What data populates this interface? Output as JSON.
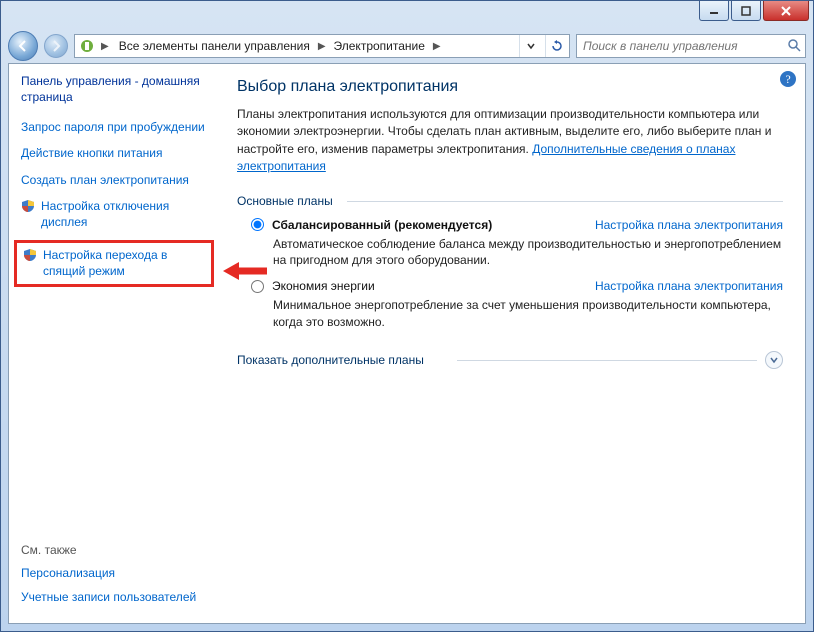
{
  "breadcrumb": {
    "item1": "Все элементы панели управления",
    "item2": "Электропитание"
  },
  "search": {
    "placeholder": "Поиск в панели управления"
  },
  "sidebar": {
    "title": "Панель управления - домашняя страница",
    "links": {
      "l0": "Запрос пароля при пробуждении",
      "l1": "Действие кнопки питания",
      "l2": "Создать план электропитания",
      "l3": "Настройка отключения дисплея",
      "l4": "Настройка перехода в спящий режим"
    },
    "seealso_head": "См. также",
    "seealso": {
      "s0": "Персонализация",
      "s1": "Учетные записи пользователей"
    }
  },
  "main": {
    "title": "Выбор плана электропитания",
    "desc_part1": "Планы электропитания используются для оптимизации производительности компьютера или экономии электроэнергии. Чтобы сделать план активным, выделите его, либо выберите план и настройте его, изменив параметры электропитания. ",
    "desc_link": "Дополнительные сведения о планах электропитания",
    "section_main": "Основные планы",
    "plans": {
      "balanced": {
        "name": "Сбалансированный (рекомендуется)",
        "settings": "Настройка плана электропитания",
        "desc": "Автоматическое соблюдение баланса между производительностью и энергопотреблением на пригодном для этого оборудовании."
      },
      "saver": {
        "name": "Экономия энергии",
        "settings": "Настройка плана электропитания",
        "desc": "Минимальное энергопотребление за счет уменьшения производительности компьютера, когда это возможно."
      }
    },
    "expand": "Показать дополнительные планы"
  }
}
